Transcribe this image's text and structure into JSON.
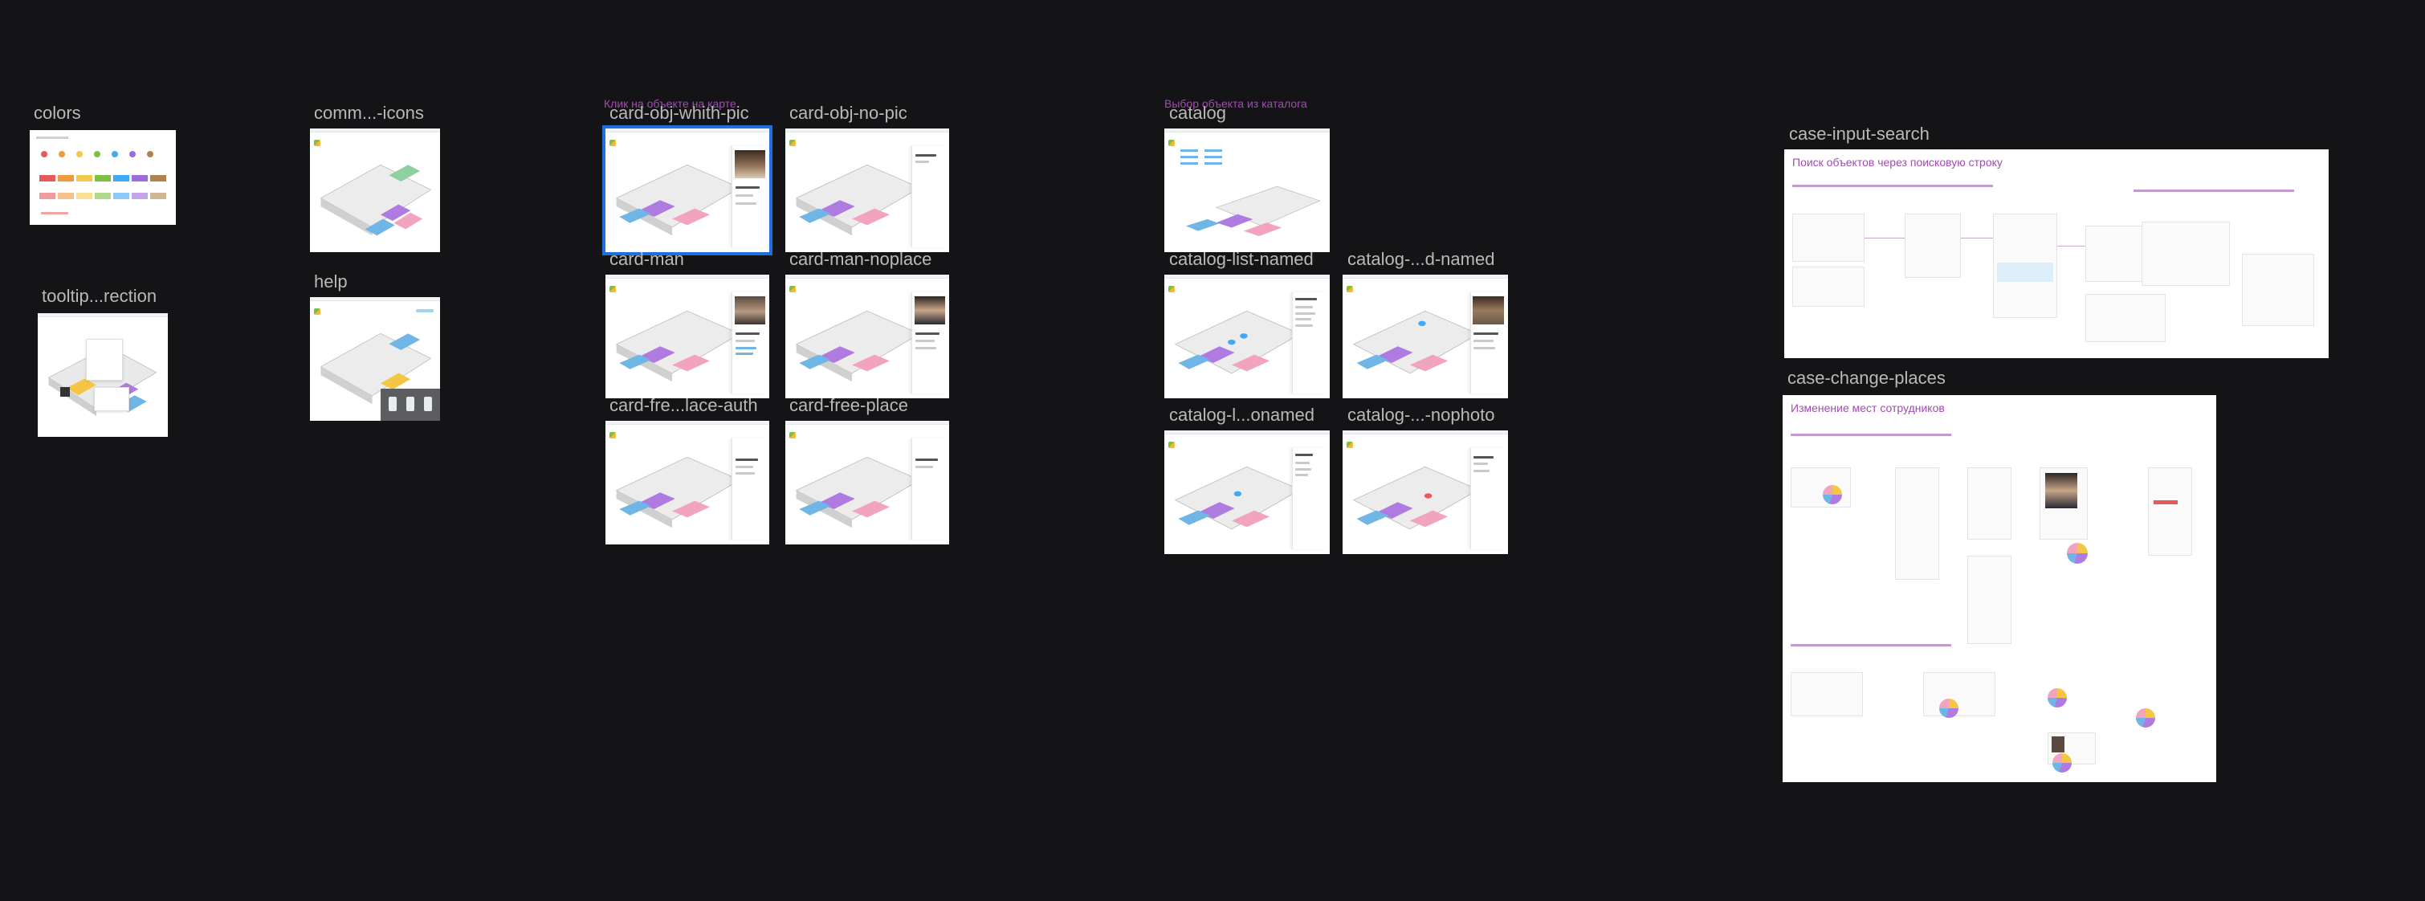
{
  "canvas": {
    "background": "#141416",
    "accent": "#a24bb4",
    "selection": "#1e6fe0"
  },
  "sections": {
    "map_click": "Клик на объекте на карте",
    "catalog_pick": "Выбор объекта из каталога"
  },
  "frames": {
    "colors": "colors",
    "common_icons": "comm...-icons",
    "tooltip_direction": "tooltip...rection",
    "help": "help",
    "card_obj_with_pic": "card-obj-whith-pic",
    "card_obj_no_pic": "card-obj-no-pic",
    "card_man": "card-man",
    "card_man_noplace": "card-man-noplace",
    "card_free_place_auth": "card-fre...lace-auth",
    "card_free_place": "card-free-place",
    "catalog": "catalog",
    "catalog_list_named": "catalog-list-named",
    "catalog_d_named": "catalog-...d-named",
    "catalog_l_onamed": "catalog-l...onamed",
    "catalog_nophoto": "catalog-...-nophoto",
    "case_input_search": "case-input-search",
    "case_change_places": "case-change-places"
  },
  "docs": {
    "search_title": "Поиск объектов через поисковую строку",
    "change_title": "Изменение мест сотрудников"
  },
  "palette": {
    "dots": [
      "#e85a5a",
      "#f09a3e",
      "#f2c94c",
      "#7bc043",
      "#3fa9f5",
      "#9b6ddc",
      "#b0834d"
    ],
    "swatches": [
      "#e85a5a",
      "#f09a3e",
      "#f2c94c",
      "#7bc043",
      "#3fa9f5",
      "#9b6ddc",
      "#b0834d"
    ]
  }
}
